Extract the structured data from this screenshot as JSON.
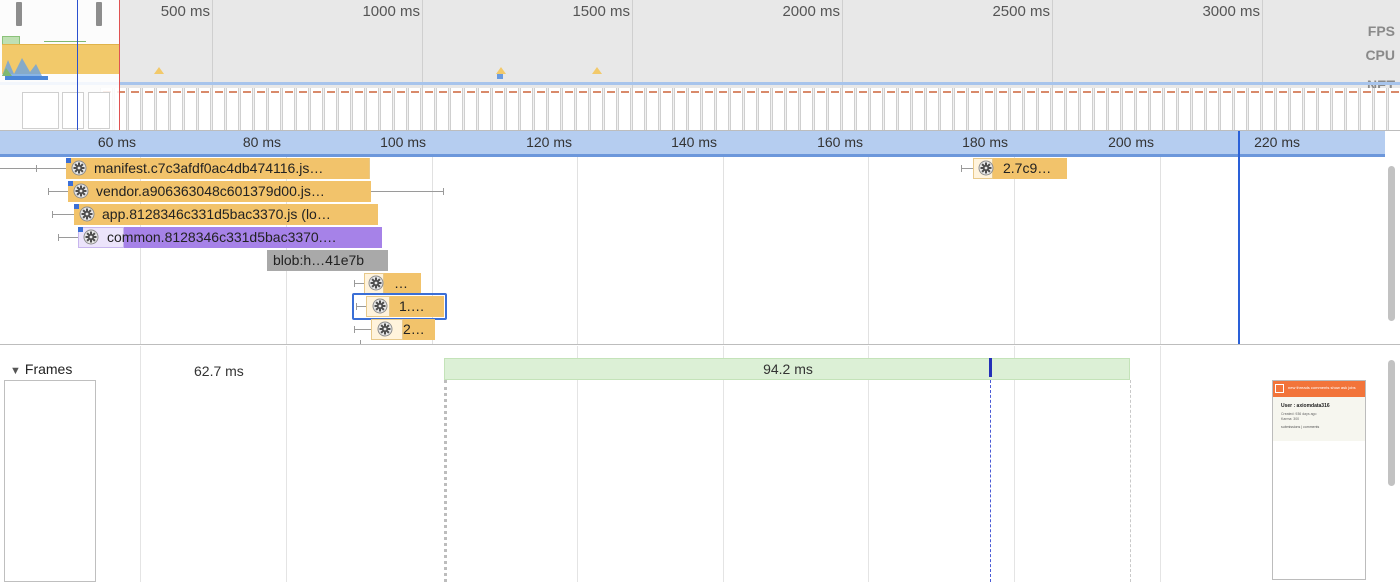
{
  "overview": {
    "ticks": [
      "500 ms",
      "1000 ms",
      "1500 ms",
      "2000 ms",
      "2500 ms",
      "3000 ms"
    ],
    "tracks": {
      "fps": "FPS",
      "cpu": "CPU",
      "net": "NET"
    }
  },
  "flame": {
    "ticks": [
      "60 ms",
      "80 ms",
      "100 ms",
      "120 ms",
      "140 ms",
      "160 ms",
      "180 ms",
      "200 ms",
      "220 ms"
    ],
    "events": [
      {
        "label": "manifest.c7c3afdf0ac4db474116.js…",
        "category": "script"
      },
      {
        "label": "vendor.a906363048c601379d00.js…",
        "category": "script"
      },
      {
        "label": "app.8128346c331d5bac3370.js (lo…",
        "category": "script"
      },
      {
        "label": "common.8128346c331d5bac3370.…",
        "category": "rendering"
      },
      {
        "label": "blob:h…41e7b",
        "category": "other"
      },
      {
        "label": "…",
        "category": "script"
      },
      {
        "label": "1.…",
        "category": "script",
        "selected": true
      },
      {
        "label": "2…",
        "category": "script"
      },
      {
        "label": "2.7c9…",
        "category": "script"
      }
    ],
    "splitter": "..."
  },
  "frames": {
    "header": "Frames",
    "durations": [
      "62.7 ms",
      "94.2 ms"
    ],
    "screenshot": {
      "nav": "new  threads  comments  show  ask  jobs",
      "user": "User : axiomdata316",
      "created": "Created: 936 days ago",
      "karma": "Karma: 300",
      "links": "submissions | comments"
    }
  },
  "colors": {
    "script": "#f2c36b",
    "rendering": "#a682e8",
    "other": "#a9a9a9",
    "ruler": "#b5cdf0",
    "cursor": "#2a60d8",
    "frame_long": "#dcf0d6",
    "screenshot_header": "#f2743a"
  },
  "icons": {
    "event": "gear-icon",
    "collapse": "triangle-down-icon"
  }
}
